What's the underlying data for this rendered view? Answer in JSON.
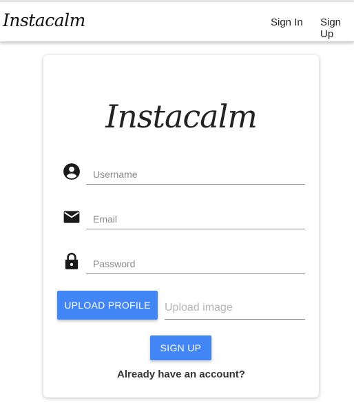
{
  "navbar": {
    "brand": "Instacalm",
    "links": [
      "Sign In",
      "Sign Up"
    ]
  },
  "card": {
    "logo_text": "Instacalm",
    "fields": [
      {
        "icon": "account-circle-icon",
        "placeholder": "Username"
      },
      {
        "icon": "mail-icon",
        "placeholder": "Email"
      },
      {
        "icon": "lock-icon",
        "placeholder": "Password"
      }
    ],
    "upload": {
      "button_label": "UPLOAD PROFILE",
      "placeholder": "Upload image"
    },
    "submit_label": "SIGN UP",
    "footer_text": "Already have an account?"
  },
  "colors": {
    "accent": "#4285f4",
    "text": "#222222",
    "underline": "#8a8a8a"
  }
}
